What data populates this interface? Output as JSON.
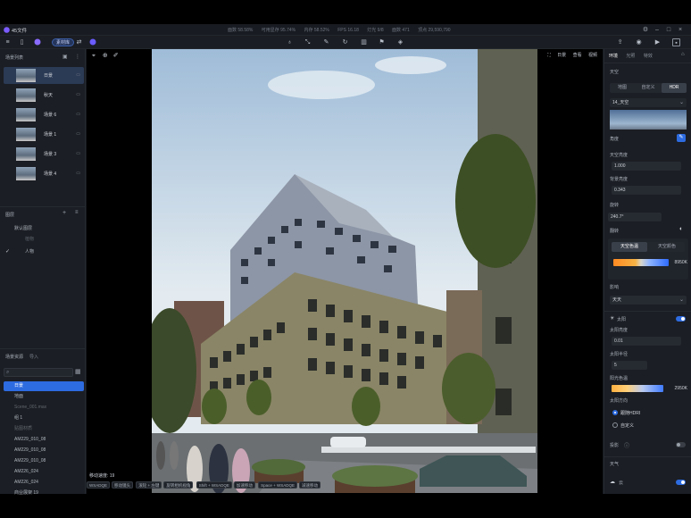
{
  "app": {
    "title": "45文件"
  },
  "stats": [
    "面数 58.58%",
    "可用显存 95.74%",
    "内存 58.52%",
    "FPS 16.18",
    "灯光 9/8",
    "面数 471",
    "顶点 29,590,790"
  ],
  "toolbar": {
    "project_label": "素材库"
  },
  "left": {
    "scene_list_title": "场景列表",
    "scenes": [
      {
        "label": "日景",
        "selected": true
      },
      {
        "label": "秋天"
      },
      {
        "label": "场景 6"
      },
      {
        "label": "场景 1"
      },
      {
        "label": "场景 3"
      },
      {
        "label": "场景 4"
      }
    ],
    "layers_title": "图层",
    "layers": [
      {
        "label": "默认图层"
      },
      {
        "label": "植物"
      },
      {
        "label": "人物",
        "checked": true
      }
    ],
    "assets_tabs": [
      "场景资源",
      "导入"
    ],
    "assets": [
      {
        "label": "日景",
        "selected": true
      },
      {
        "label": "地面"
      },
      {
        "label": "Scene_001.max"
      },
      {
        "label": "组 1"
      },
      {
        "label": "贴图材质"
      },
      {
        "label": "AM229_010_08"
      },
      {
        "label": "AM229_010_08"
      },
      {
        "label": "AM229_010_08"
      },
      {
        "label": "AM226_024"
      },
      {
        "label": "AM226_024"
      },
      {
        "label": "商业展架 19"
      },
      {
        "label": "商业展架 19"
      }
    ]
  },
  "viewport": {
    "right_tools": [
      "日景",
      "查看",
      "视频"
    ],
    "move_speed": "移动速度: 19",
    "hints": [
      "WSADQE",
      "移动镜头",
      "滚轮 + 左键",
      "旋转相机视角",
      "Shift + WSADQE",
      "加速移动",
      "Space + WSADQE",
      "减速移动"
    ]
  },
  "right": {
    "tabs": [
      "环境",
      "光照",
      "特效"
    ],
    "sky_title": "天空",
    "sky_modes": [
      "地图",
      "自定义",
      "HDR"
    ],
    "sky_selected": "HDR",
    "sky_preset": "14_天空",
    "angle_label": "角度",
    "sky_brightness_label": "天空亮度",
    "sky_brightness": "1.000",
    "bg_brightness_label": "背景亮度",
    "bg_brightness": "0.343",
    "rotation_label": "旋转",
    "rotation": "240.7°",
    "flip_label": "翻转",
    "color_tabs": [
      "天空色温",
      "天空颜色"
    ],
    "color_temp": "8950K",
    "weather_label": "影响",
    "weather": "天天",
    "sun_label": "太阳",
    "sun_brightness_label": "太阳亮度",
    "sun_brightness": "0.01",
    "sun_radius_label": "太阳半径",
    "sun_radius": "5",
    "sun_color_label": "阳光色温",
    "sun_color_temp": "2950K",
    "sun_dir_label": "太阳方向",
    "sun_dir_options": [
      "跟随HDRI",
      "自定义"
    ],
    "shadow_label": "投影",
    "weather_title": "天气",
    "cloud_label": "云"
  },
  "colors": {
    "accent": "#2d6be0",
    "panel": "#1b1e24"
  }
}
